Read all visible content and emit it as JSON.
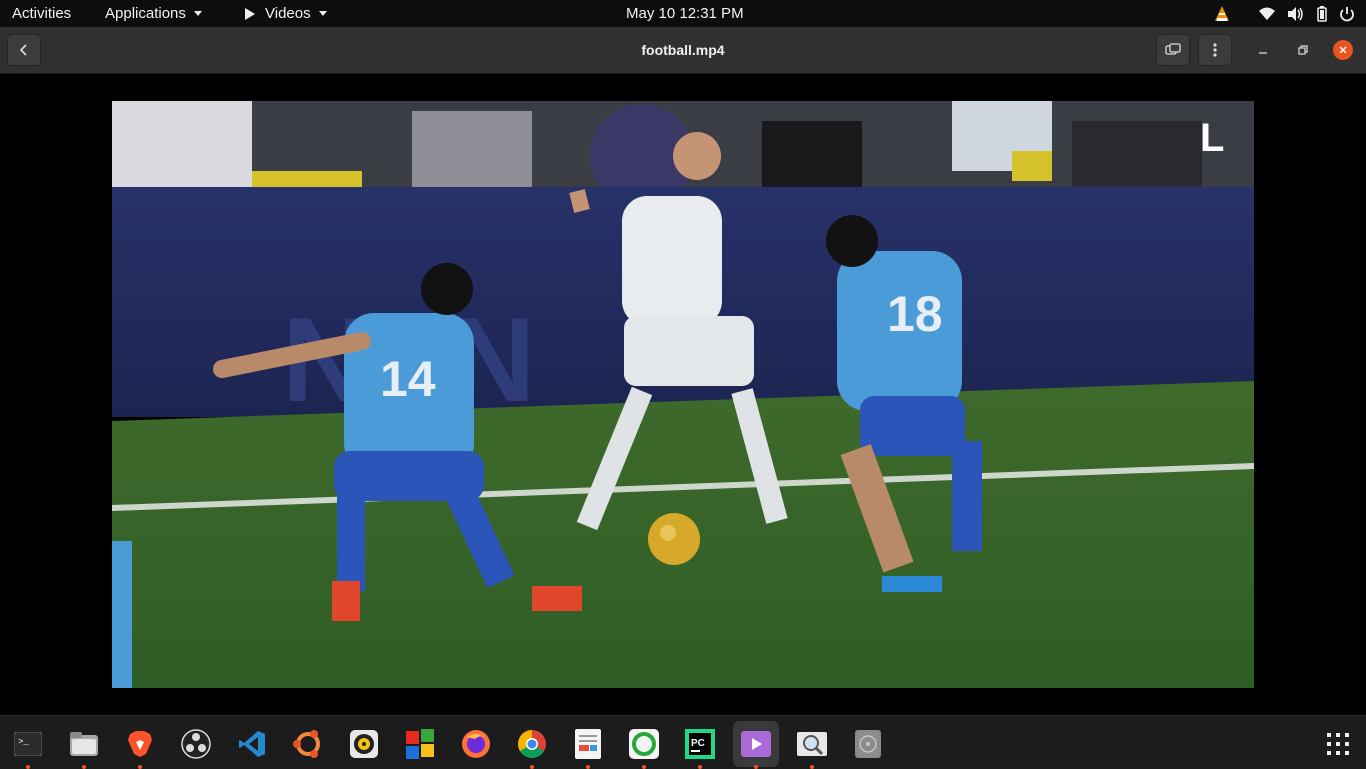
{
  "topbar": {
    "activities": "Activities",
    "applications": "Applications",
    "current_app": "Videos",
    "datetime": "May 10  12:31 PM",
    "tray_icons": [
      "vlc-icon",
      "wifi-icon",
      "volume-icon",
      "battery-icon",
      "power-icon"
    ]
  },
  "header": {
    "title": "football.mp4",
    "back_icon": "chevron-left-icon",
    "pip_icon": "picture-in-picture-icon",
    "menu_icon": "kebab-menu-icon"
  },
  "video": {
    "player_numbers": [
      "14",
      "18"
    ],
    "watermark": "L"
  },
  "dock": {
    "apps": [
      {
        "name": "terminal",
        "icon": "terminal-icon",
        "running": true
      },
      {
        "name": "files",
        "icon": "folder-icon",
        "running": true
      },
      {
        "name": "brave",
        "icon": "brave-icon",
        "running": true
      },
      {
        "name": "obs",
        "icon": "obs-icon",
        "running": false
      },
      {
        "name": "vscode",
        "icon": "vscode-icon",
        "running": false
      },
      {
        "name": "ubuntu-software",
        "icon": "ubuntu-icon",
        "running": false
      },
      {
        "name": "rhythmbox",
        "icon": "rhythmbox-icon",
        "running": false
      },
      {
        "name": "windows",
        "icon": "windows-icon",
        "running": false
      },
      {
        "name": "firefox",
        "icon": "firefox-icon",
        "running": false
      },
      {
        "name": "chrome",
        "icon": "chrome-icon",
        "running": true
      },
      {
        "name": "text-editor",
        "icon": "document-icon",
        "running": true
      },
      {
        "name": "circle-app",
        "icon": "ring-icon",
        "running": true
      },
      {
        "name": "pycharm",
        "icon": "pycharm-icon",
        "running": true
      },
      {
        "name": "videos",
        "icon": "video-player-icon",
        "running": true,
        "active": true
      },
      {
        "name": "image-viewer",
        "icon": "image-viewer-icon",
        "running": true
      },
      {
        "name": "disks",
        "icon": "disk-icon",
        "running": false
      }
    ],
    "grid_icon": "show-apps-grid-icon"
  },
  "colors": {
    "accent": "#e95420",
    "topbar": "#0d0d0d",
    "headerbar": "#303030",
    "dock": "#1c1c1c"
  }
}
